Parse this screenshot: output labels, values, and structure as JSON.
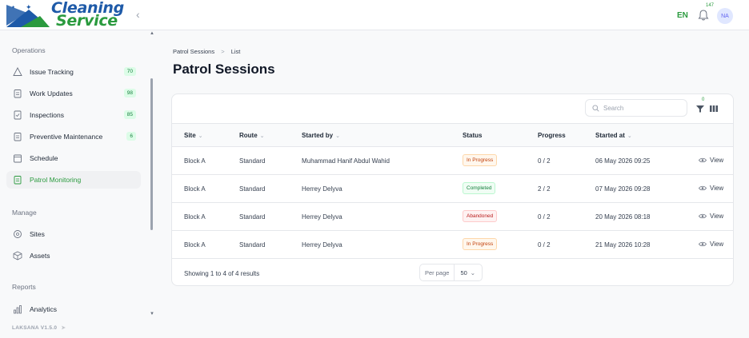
{
  "app": {
    "logo_line1": "Cleaning",
    "logo_line2": "Service",
    "version": "LAKSANA V1.5.0",
    "brand_blue": "#1e5aa8",
    "brand_green": "#2a9a3e"
  },
  "topbar": {
    "language": "EN",
    "notification_count": "147",
    "avatar_initials": "NA"
  },
  "sidebar": {
    "sections": [
      {
        "label": "Operations"
      },
      {
        "label": "Manage"
      },
      {
        "label": "Reports"
      }
    ],
    "items": [
      {
        "label": "Issue Tracking",
        "icon": "warning-icon",
        "badge": "70"
      },
      {
        "label": "Work Updates",
        "icon": "clipboard-icon",
        "badge": "98"
      },
      {
        "label": "Inspections",
        "icon": "check-doc-icon",
        "badge": "85"
      },
      {
        "label": "Preventive Maintenance",
        "icon": "clipboard-icon",
        "badge": "6"
      },
      {
        "label": "Schedule",
        "icon": "calendar-icon"
      },
      {
        "label": "Patrol Monitoring",
        "icon": "clipboard-icon",
        "active": true
      },
      {
        "label": "Sites",
        "icon": "location-icon"
      },
      {
        "label": "Assets",
        "icon": "box-icon"
      },
      {
        "label": "Analytics",
        "icon": "bar-chart-icon"
      }
    ]
  },
  "main": {
    "breadcrumb": [
      "Patrol Sessions",
      ">",
      "List"
    ],
    "title": "Patrol Sessions",
    "search_placeholder": "Search",
    "filter_count": "0",
    "columns": {
      "site": "Site",
      "route": "Route",
      "started_by": "Started by",
      "status": "Status",
      "progress": "Progress",
      "started_at": "Started at"
    },
    "rows": [
      {
        "site": "Block A",
        "route": "Standard",
        "started_by": "Muhammad Hanif Abdul Wahid",
        "status": "In Progress",
        "status_kind": "progress",
        "progress": "0 / 2",
        "started_at": "06 May 2026 09:25",
        "action": "View"
      },
      {
        "site": "Block A",
        "route": "Standard",
        "started_by": "Herrey Delyva",
        "status": "Completed",
        "status_kind": "completed",
        "progress": "2 / 2",
        "started_at": "07 May 2026 09:28",
        "action": "View"
      },
      {
        "site": "Block A",
        "route": "Standard",
        "started_by": "Herrey Delyva",
        "status": "Abandoned",
        "status_kind": "abandoned",
        "progress": "0 / 2",
        "started_at": "20 May 2026 08:18",
        "action": "View"
      },
      {
        "site": "Block A",
        "route": "Standard",
        "started_by": "Herrey Delyva",
        "status": "In Progress",
        "status_kind": "progress",
        "progress": "0 / 2",
        "started_at": "21 May 2026 10:28",
        "action": "View"
      }
    ],
    "footer": {
      "showing": "Showing 1 to 4 of 4 results",
      "per_page_label": "Per page",
      "per_page_value": "50"
    }
  }
}
